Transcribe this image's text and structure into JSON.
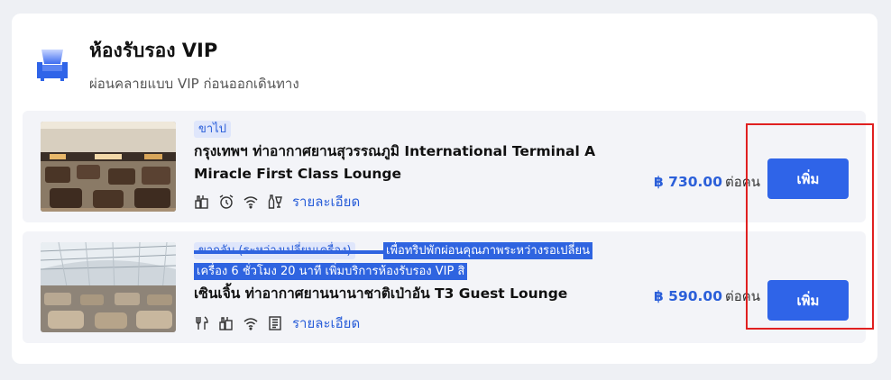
{
  "section": {
    "title": "ห้องรับรอง VIP",
    "subtitle": "ผ่อนคลายแบบ VIP ก่อนออกเดินทาง",
    "icon": "sofa-icon",
    "accent": "#2f64e8"
  },
  "lounges": [
    {
      "tag": "ขาไป",
      "promo": "",
      "name": "กรุงเทพฯ ท่าอากาศยานสุวรรณภูมิ International Terminal A Miracle First Class Lounge",
      "amenities": [
        "drink-icon",
        "alarm-clock-icon",
        "wifi-icon",
        "beverage-bottle-icon"
      ],
      "details_label": "รายละเอียด",
      "price": "฿ 730.00",
      "per_unit": "ต่อคน",
      "add_label": "เพิ่ม"
    },
    {
      "tag": "ขากลับ (ระหว่างเปลี่ยนเครื่อง)",
      "promo": "เพื่อทริปพักผ่อนคุณภาพระหว่างรอเปลี่ยนเครื่อง 6 ชั่วโมง 20 นาที เพิ่มบริการห้องรับรอง VIP สิ",
      "name": "เซินเจิ้น ท่าอากาศยานนานาชาติเป่าอัน T3 Guest Lounge",
      "amenities": [
        "food-icon",
        "drink-icon",
        "wifi-icon",
        "newspaper-icon"
      ],
      "details_label": "รายละเอียด",
      "price": "฿ 590.00",
      "per_unit": "ต่อคน",
      "add_label": "เพิ่ม"
    }
  ]
}
